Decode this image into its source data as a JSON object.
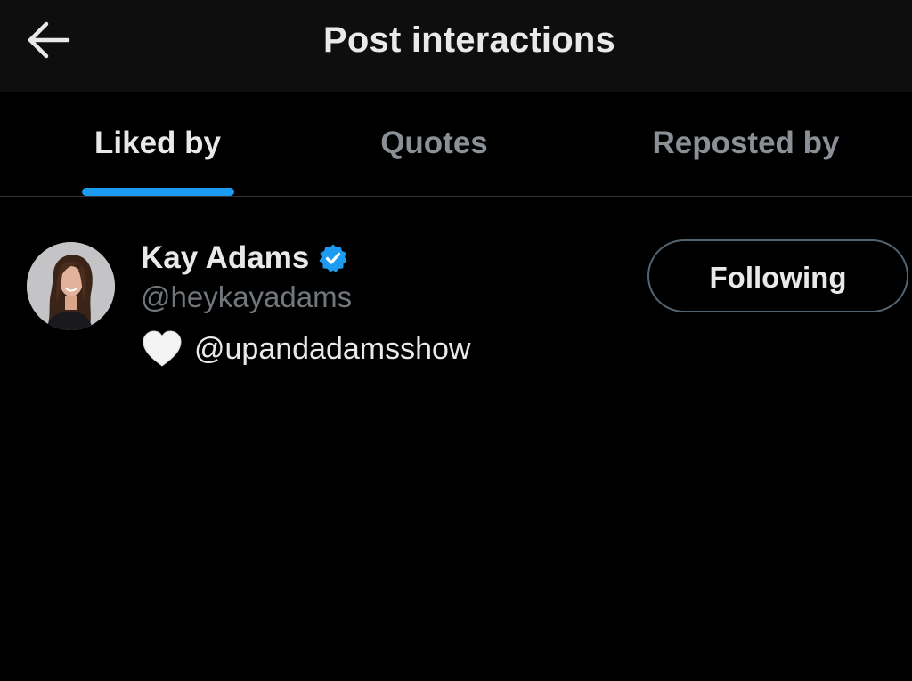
{
  "header": {
    "title": "Post interactions",
    "back_icon": "arrow-left-icon",
    "background": "#0e0e0e"
  },
  "tabs": [
    {
      "label": "Liked by",
      "active": true
    },
    {
      "label": "Quotes",
      "active": false
    },
    {
      "label": "Reposted by",
      "active": false
    }
  ],
  "colors": {
    "accent": "#1d9bf0",
    "text_primary": "#e7e9ea",
    "text_secondary": "#71767b",
    "background": "#000000"
  },
  "users": [
    {
      "display_name": "Kay Adams",
      "verified": true,
      "verified_icon": "verified-badge-icon",
      "handle": "@heykayadams",
      "bio_emoji": "white-heart-icon",
      "bio_text": "@upandadamsshow",
      "follow_button_label": "Following"
    }
  ]
}
